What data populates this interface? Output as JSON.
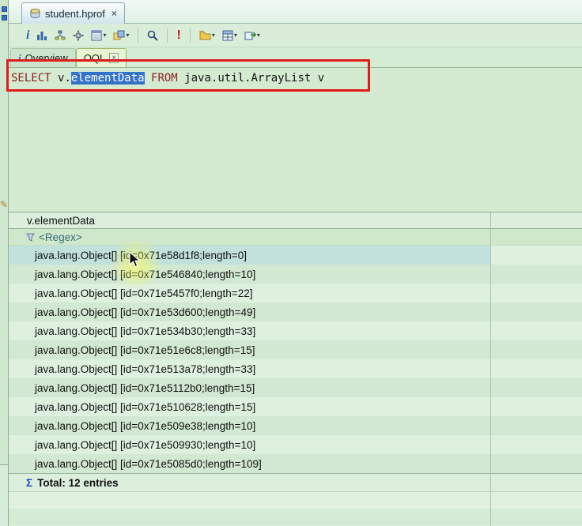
{
  "editor_tab": {
    "title": "student.hprof",
    "close": "×"
  },
  "toolbar": {
    "icons": [
      {
        "name": "info-icon",
        "glyph": "i"
      },
      {
        "name": "histogram-icon"
      },
      {
        "name": "dominator-tree-icon"
      },
      {
        "name": "gear-icon"
      },
      {
        "name": "report-dropdown"
      },
      {
        "name": "query-browser-dropdown"
      },
      {
        "name": "search-icon"
      },
      {
        "name": "leak-report-icon",
        "glyph": "!"
      },
      {
        "name": "folder-dropdown"
      },
      {
        "name": "table-view-dropdown"
      },
      {
        "name": "export-dropdown"
      }
    ],
    "caret": "▾"
  },
  "pane_tabs": {
    "overview": {
      "icon": "i",
      "label": "Overview"
    },
    "oql": {
      "label": "OQL",
      "close": "×"
    }
  },
  "query": {
    "parts": [
      {
        "text": "SELECT ",
        "type": "keyword"
      },
      {
        "text": "v.",
        "type": "plain"
      },
      {
        "text": "elementData",
        "type": "selected"
      },
      {
        "text": " FROM ",
        "type": "keyword"
      },
      {
        "text": "java.util.ArrayList v",
        "type": "plain"
      }
    ]
  },
  "table": {
    "columns": [
      {
        "header": "v.elementData"
      },
      {
        "header": ""
      }
    ],
    "filter": "<Regex>",
    "selected_row_index": 0,
    "rows": [
      "java.lang.Object[] [id=0x71e58d1f8;length=0]",
      "java.lang.Object[] [id=0x71e546840;length=10]",
      "java.lang.Object[] [id=0x71e5457f0;length=22]",
      "java.lang.Object[] [id=0x71e53d600;length=49]",
      "java.lang.Object[] [id=0x71e534b30;length=33]",
      "java.lang.Object[] [id=0x71e51e6c8;length=15]",
      "java.lang.Object[] [id=0x71e513a78;length=33]",
      "java.lang.Object[] [id=0x71e5112b0;length=15]",
      "java.lang.Object[] [id=0x71e510628;length=15]",
      "java.lang.Object[] [id=0x71e509e38;length=10]",
      "java.lang.Object[] [id=0x71e509930;length=10]",
      "java.lang.Object[] [id=0x71e5085d0;length=109]"
    ],
    "total": {
      "sigma": "Σ",
      "label": "Total: 12 entries"
    }
  },
  "left_strip": {
    "pencil": "✎"
  },
  "colors": {
    "annotation_red": "#e01b1b",
    "selection_blue": "#3272c8"
  }
}
